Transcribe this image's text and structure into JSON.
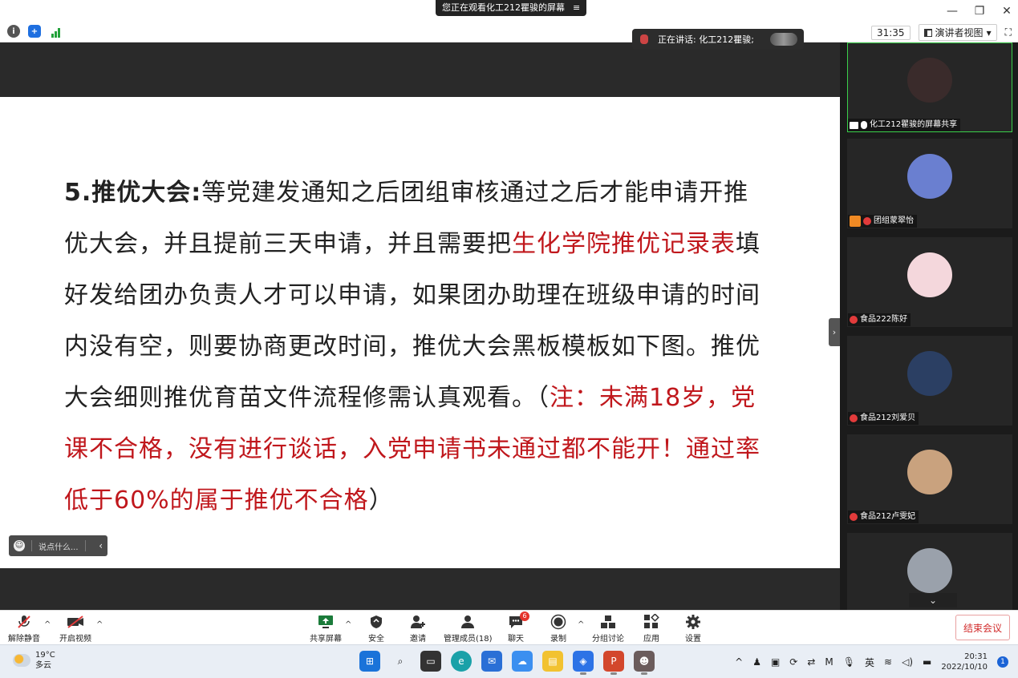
{
  "titlebar": {
    "share_notice": "您正在观看化工212瞿骏的屏幕",
    "menu_icon": "≡"
  },
  "status": {
    "timer": "31:35",
    "view_mode": "演讲者视图"
  },
  "speaking": {
    "text": "正在讲话: 化工212瞿骏;"
  },
  "slide": {
    "heading": "5.推优大会:",
    "text_a": "等党建发通知之后团组审核通过之后才能申请开推优大会，并且提前三天申请，并且需要把",
    "highlight_a": "生化学院推优记录表",
    "text_b": "填好发给团办负责人才可以申请，如果团办助理在班级申请的时间内没有空，则要协商更改时间，推优大会黑板模板如下图。推优大会细则推优育苗文件流程修需认真观看。",
    "paren_open": "（",
    "note_red": "注：未满18岁，党课不合格，没有进行谈话，入党申请书未通过都不能开！通过率低于60%的属于推优不合格",
    "paren_close": "）"
  },
  "chat": {
    "placeholder": "说点什么..."
  },
  "participants": [
    {
      "label": "化工212瞿骏的屏幕共享",
      "avatar_color": "#3a2b2b"
    },
    {
      "label": "团组蒙翠怡",
      "avatar_color": "#6a7fd0"
    },
    {
      "label": "食品222陈好",
      "avatar_color": "#f4d7dc"
    },
    {
      "label": "食品212刘爱贝",
      "avatar_color": "#2b3f63"
    },
    {
      "label": "食品212卢雯妃",
      "avatar_color": "#c9a27e"
    },
    {
      "label": "",
      "avatar_color": "#9aa1ab"
    }
  ],
  "toolbar": {
    "mute": "解除静音",
    "video": "开启视频",
    "share": "共享屏幕",
    "security": "安全",
    "invite": "邀请",
    "members": "管理成员(18)",
    "chat": "聊天",
    "chat_badge": "6",
    "record": "录制",
    "breakout": "分组讨论",
    "apps": "应用",
    "settings": "设置",
    "end": "结束会议"
  },
  "taskbar": {
    "temp": "19°C",
    "weather": "多云",
    "ime": "英",
    "time": "20:31",
    "date": "2022/10/10",
    "notif_count": "1"
  }
}
